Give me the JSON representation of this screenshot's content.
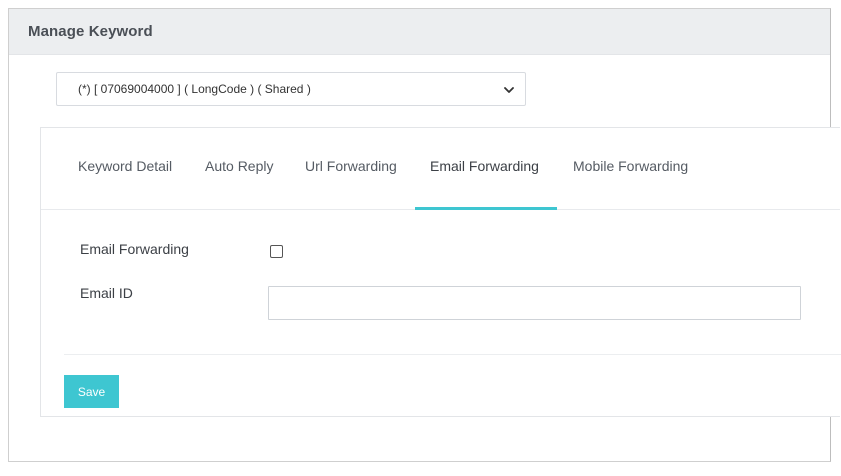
{
  "page": {
    "title": "Manage Keyword"
  },
  "number_select": {
    "selected": "(*) [ 07069004000 ] ( LongCode ) ( Shared )"
  },
  "tabs": [
    {
      "label": "Keyword Detail",
      "active": false
    },
    {
      "label": "Auto Reply",
      "active": false
    },
    {
      "label": "Url Forwarding",
      "active": false
    },
    {
      "label": "Email Forwarding",
      "active": true
    },
    {
      "label": "Mobile Forwarding",
      "active": false
    }
  ],
  "form": {
    "email_forwarding_label": "Email Forwarding",
    "email_forwarding_checked": false,
    "email_id_label": "Email ID",
    "email_id_value": "",
    "save_label": "Save"
  },
  "colors": {
    "accent": "#3ec6d1",
    "header_bg": "#eceef0"
  }
}
